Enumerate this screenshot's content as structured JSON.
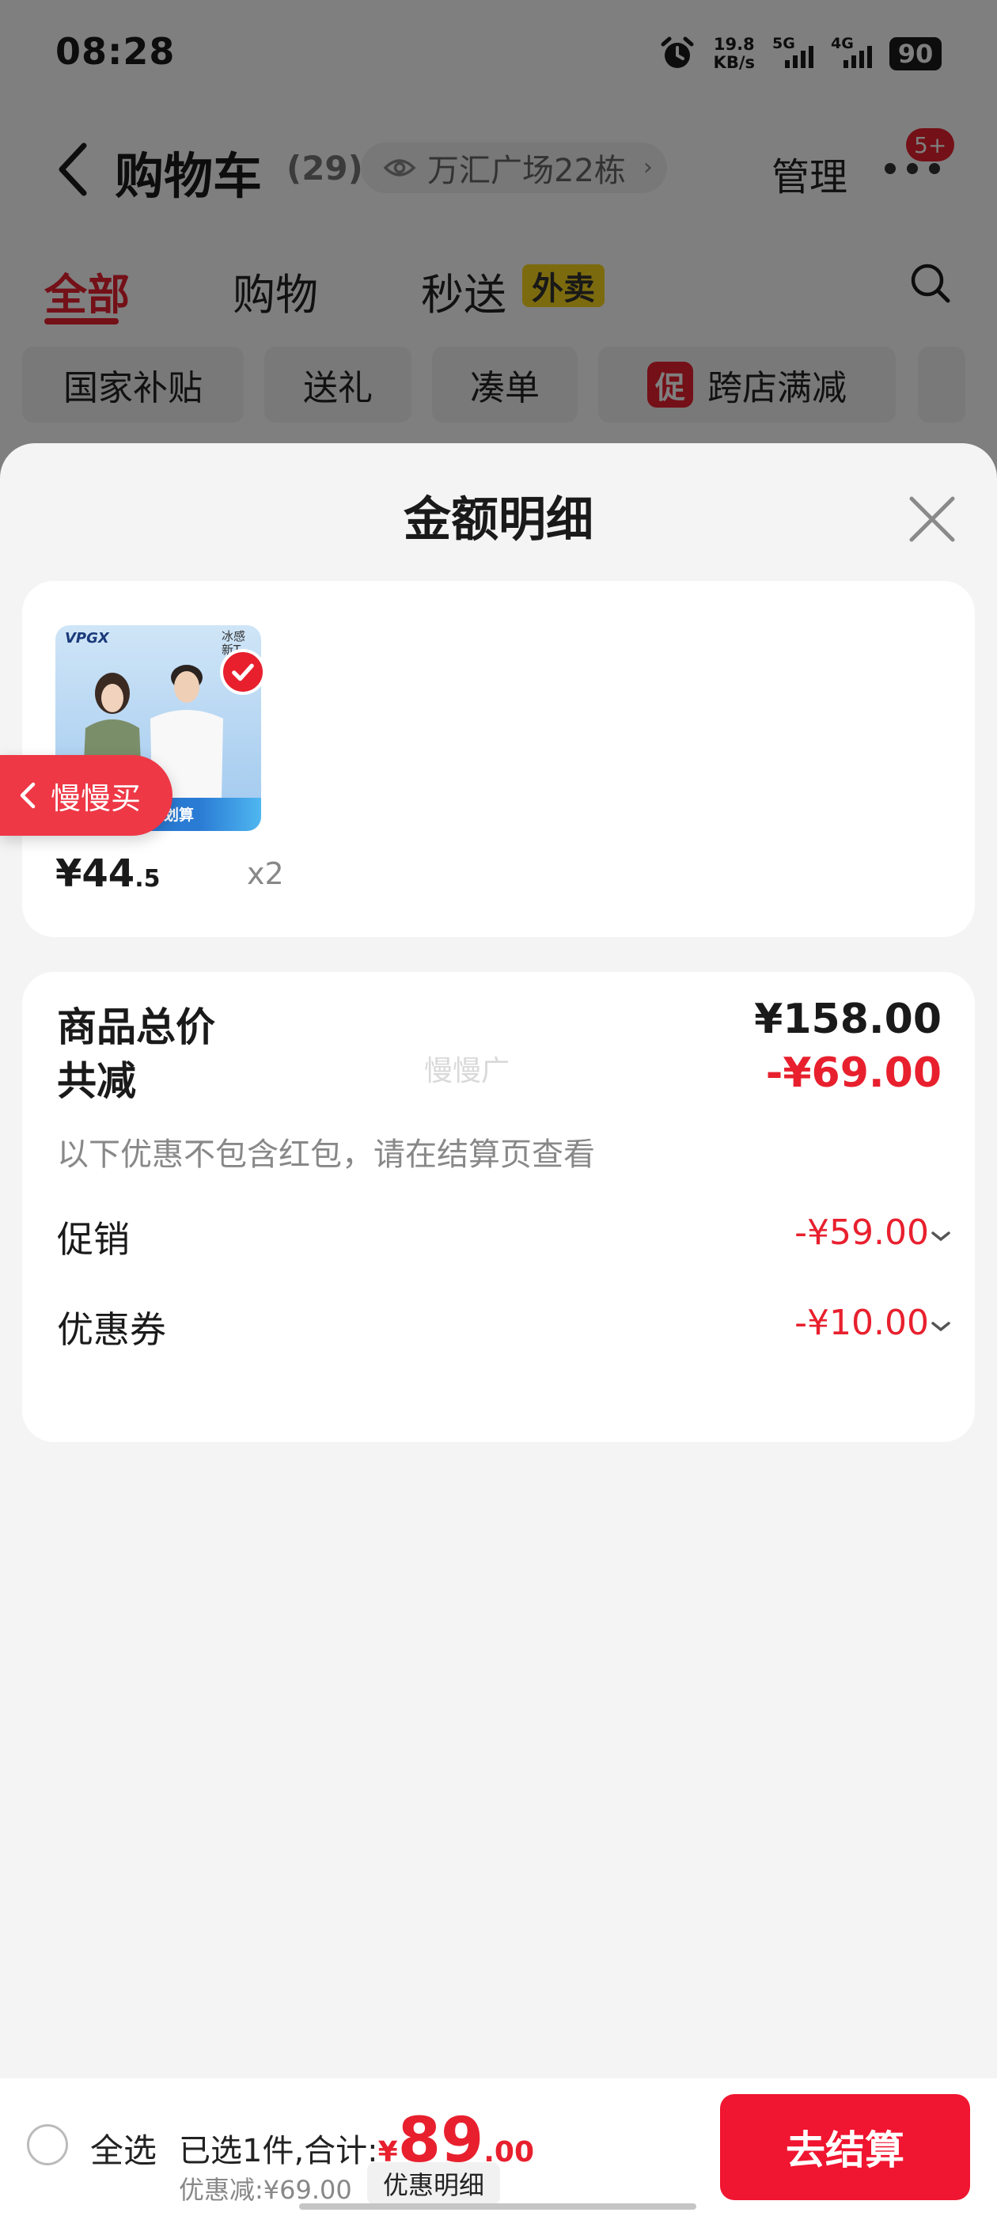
{
  "status_bar": {
    "time": "08:28",
    "speed_value": "19.8",
    "speed_unit": "KB/s",
    "net1": "5G",
    "net2": "4G",
    "battery": "90"
  },
  "header": {
    "title": "购物车",
    "count": "(29)",
    "location": "万汇广场22栋",
    "manage": "管理",
    "badge": "5+"
  },
  "tabs": [
    {
      "label": "全部",
      "active": true
    },
    {
      "label": "购物",
      "active": false
    },
    {
      "label": "秒送",
      "active": false
    }
  ],
  "takeout_tag": "外卖",
  "chips": [
    "国家补贴",
    "送礼",
    "凑单",
    "跨店满减"
  ],
  "promo_mark": "促",
  "sheet": {
    "title": "金额明细"
  },
  "product": {
    "brand": "VPGX",
    "tag": "冰感 新T",
    "strip_text": "预划算",
    "price_int": "¥44",
    "price_dec": ".5",
    "qty": "x2"
  },
  "slow_buy": "慢慢买",
  "watermark": "慢慢广",
  "summary": {
    "total_label": "商品总价",
    "total_value": "¥158.00",
    "reduce_label": "共减",
    "reduce_value": "-¥69.00",
    "note": "以下优惠不包含红包，请在结算页查看",
    "promo_label": "促销",
    "promo_value": "-¥59.00",
    "coupon_label": "优惠券",
    "coupon_value": "-¥10.00"
  },
  "bottom": {
    "select_all": "全选",
    "selected_text": "已选1件,合计:",
    "currency": "¥",
    "price_int": "89",
    "price_dec": ".00",
    "discount_text": "优惠减:¥69.00",
    "detail_btn": "优惠明细",
    "checkout": "去结算"
  },
  "colors": {
    "accent": "#e8202e",
    "checkout": "#f01530",
    "takeout": "#f9d71c"
  }
}
